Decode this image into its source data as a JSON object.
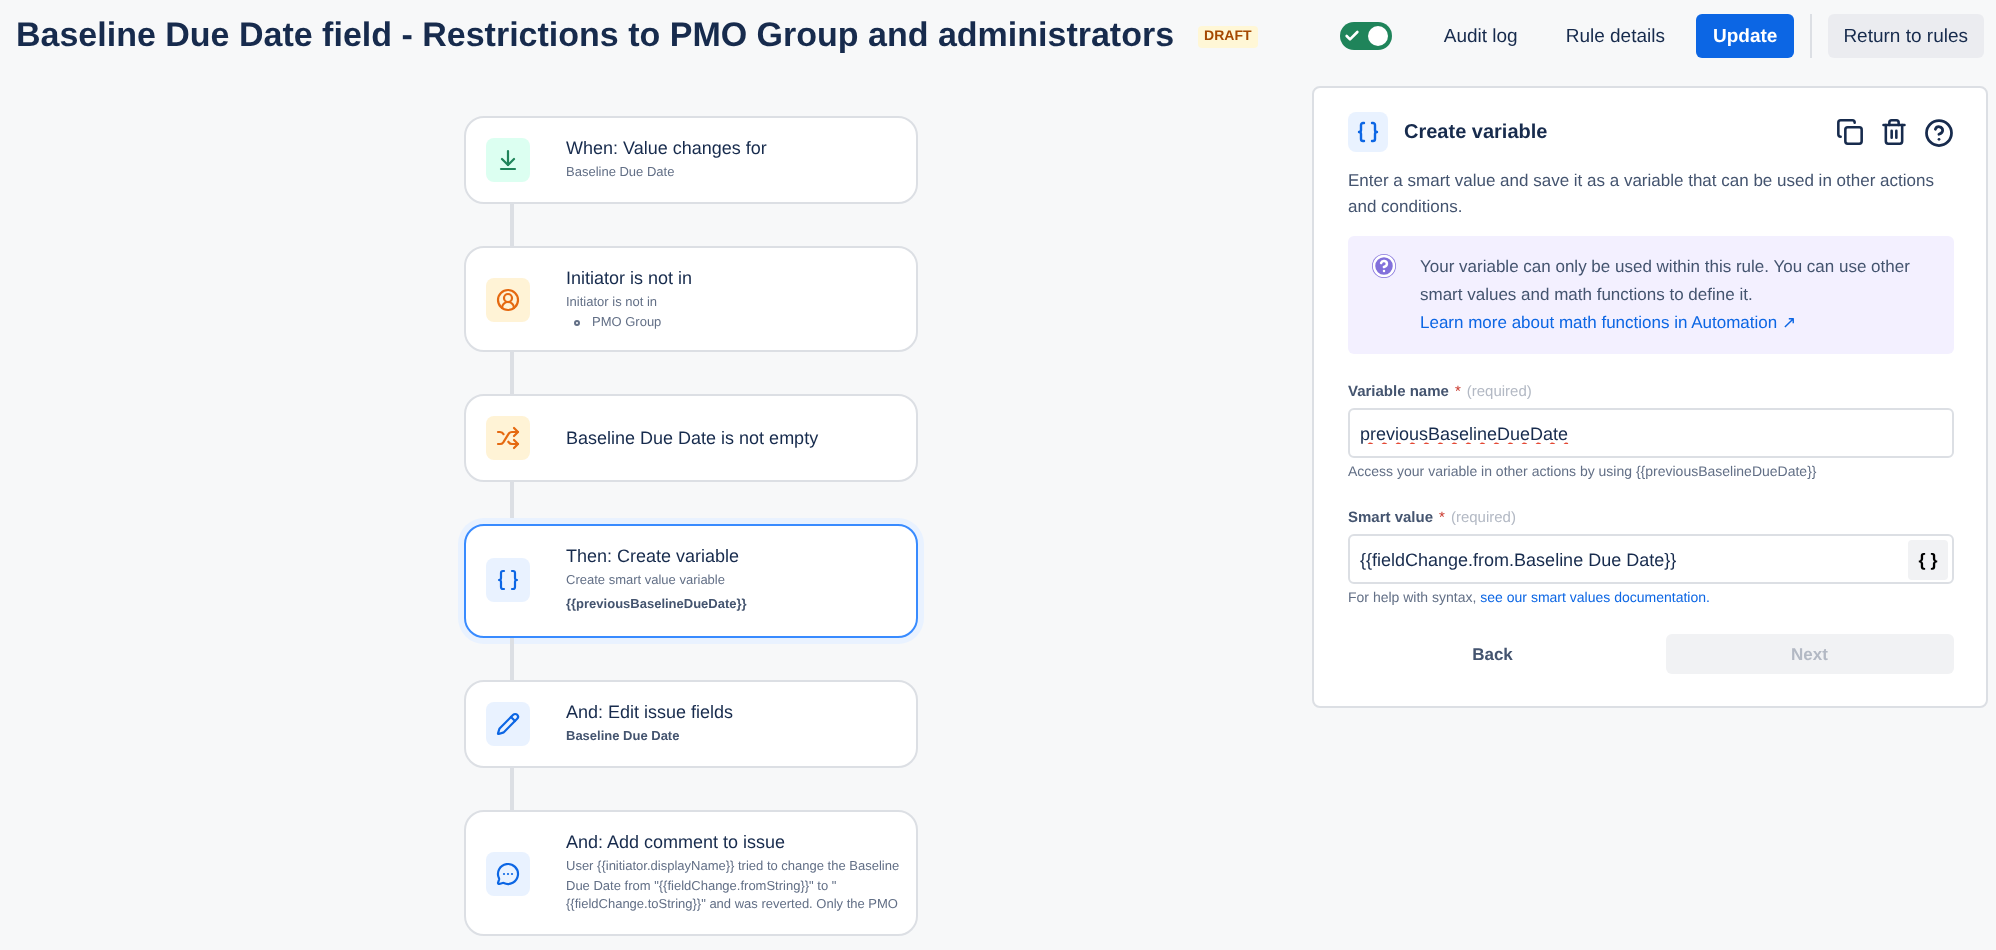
{
  "header": {
    "title": "Baseline Due Date field - Restrictions to PMO Group and administrators",
    "badge": "DRAFT",
    "toggle": {
      "on": true
    },
    "buttons": [
      {
        "label": "Audit log",
        "kind": "subtle"
      },
      {
        "label": "Rule details",
        "kind": "subtle"
      },
      {
        "label": "Update",
        "kind": "primary"
      },
      {
        "label": "Return to rules",
        "kind": "default"
      }
    ]
  },
  "flow": [
    {
      "kind": "trigger",
      "title": "When: Value changes for",
      "selected": false,
      "lines": [
        {
          "text": "Baseline Due Date",
          "kind": "plain"
        }
      ]
    },
    {
      "kind": "user",
      "title": "Initiator is not in",
      "selected": false,
      "lines": [
        {
          "text": "Initiator is not in",
          "kind": "plain"
        },
        {
          "text": "PMO Group",
          "kind": "bullet"
        }
      ]
    },
    {
      "kind": "branch",
      "title": "Baseline Due Date is not empty",
      "selected": false
    },
    {
      "kind": "variable",
      "title": "Then: Create variable",
      "selected": true,
      "lines": [
        {
          "text": "Create smart value variable",
          "kind": "plain"
        },
        {
          "text": "{{previousBaselineDueDate}}",
          "kind": "bold"
        }
      ]
    },
    {
      "kind": "edit",
      "title": "And: Edit issue fields",
      "selected": false,
      "lines": [
        {
          "text": "Baseline Due Date",
          "kind": "bold"
        }
      ]
    },
    {
      "kind": "comment",
      "title": "And: Add comment to issue",
      "selected": false,
      "lines": [
        {
          "text": "User {{initiator.displayName}} tried to change the Baseline Due Date from \"{{fieldChange.fromString}}\" to \"{{fieldChange.toString}}\" and was reverted. Only the PMO",
          "kind": "plain"
        }
      ]
    }
  ],
  "panel": {
    "title": "Create variable",
    "description": "Enter a smart value and save it as a variable that can be used in other actions and conditions.",
    "info": {
      "text": "Your variable can only be used within this rule. You can use other smart values and math functions to define it.",
      "link": "Learn more about math functions in Automation ↗"
    },
    "fields": [
      {
        "label": "Variable name",
        "required_mark": "*",
        "required": "(required)",
        "value": "previousBaselineDueDate",
        "helper": "Access your variable in other actions by using {{previousBaselineDueDate}}",
        "kind": "plain"
      },
      {
        "label": "Smart value",
        "required_mark": "*",
        "required": "(required)",
        "value": "{{fieldChange.from.Baseline Due Date}}",
        "helper": "For help with syntax,",
        "helper_link": "see our smart values documentation.",
        "kind": "smart",
        "button": "{ }"
      }
    ],
    "back": "Back",
    "next": {
      "label": "Next",
      "disabled": true
    }
  }
}
